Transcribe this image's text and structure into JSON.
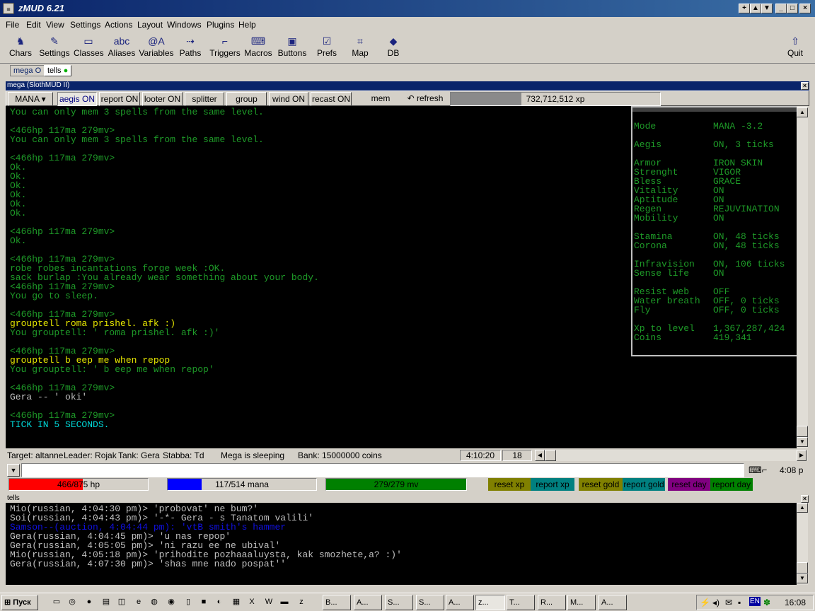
{
  "title": "zMUD 6.21",
  "menu": [
    "File",
    "Edit",
    "View",
    "Settings",
    "Actions",
    "Layout",
    "Windows",
    "Plugins",
    "Help"
  ],
  "toolbar": [
    {
      "label": "Chars",
      "icon": "chars-icon",
      "glyph": "♞"
    },
    {
      "label": "Settings",
      "icon": "settings-icon",
      "glyph": "✎"
    },
    {
      "label": "Classes",
      "icon": "folder-icon",
      "glyph": "▭"
    },
    {
      "label": "Aliases",
      "icon": "aliases-icon",
      "glyph": "abc"
    },
    {
      "label": "Variables",
      "icon": "variables-icon",
      "glyph": "@A"
    },
    {
      "label": "Paths",
      "icon": "paths-icon",
      "glyph": "⇢"
    },
    {
      "label": "Triggers",
      "icon": "triggers-icon",
      "glyph": "⌐"
    },
    {
      "label": "Macros",
      "icon": "macros-icon",
      "glyph": "⌨"
    },
    {
      "label": "Buttons",
      "icon": "buttons-icon",
      "glyph": "▣"
    },
    {
      "label": "Prefs",
      "icon": "prefs-icon",
      "glyph": "☑"
    },
    {
      "label": "Map",
      "icon": "map-icon",
      "glyph": "⌗"
    },
    {
      "label": "DB",
      "icon": "db-icon",
      "glyph": "◆"
    }
  ],
  "quit_label": "Quit",
  "sessions": [
    {
      "label": "mega",
      "status": "O"
    },
    {
      "label": "tells",
      "status": "●"
    }
  ],
  "mega_window_title": "mega (SlothMUD II)",
  "buttons": [
    "MANA",
    "aegis ON",
    "report ON",
    "looter ON",
    "splitter ON",
    "group OFF",
    "wind ON",
    "recast ON",
    "mem",
    "refresh"
  ],
  "xp_display": "732,712,512 xp",
  "colors": {
    "green": "#1e9a28",
    "yellow": "#e6e600",
    "cyan": "#00d7d7",
    "white": "#c0c0c0",
    "blue": "#1010e0"
  },
  "terminal_lines": [
    {
      "t": "You can only mem 3 spells from the same level.",
      "c": "green"
    },
    {
      "t": "",
      "c": "green"
    },
    {
      "t": "<466hp 117ma 279mv>",
      "c": "green"
    },
    {
      "t": "You can only mem 3 spells from the same level.",
      "c": "green"
    },
    {
      "t": "",
      "c": "green"
    },
    {
      "t": "<466hp 117ma 279mv>",
      "c": "green"
    },
    {
      "t": "Ok.",
      "c": "green"
    },
    {
      "t": "Ok.",
      "c": "green"
    },
    {
      "t": "Ok.",
      "c": "green"
    },
    {
      "t": "Ok.",
      "c": "green"
    },
    {
      "t": "Ok.",
      "c": "green"
    },
    {
      "t": "Ok.",
      "c": "green"
    },
    {
      "t": "",
      "c": "green"
    },
    {
      "t": "<466hp 117ma 279mv>",
      "c": "green"
    },
    {
      "t": "Ok.",
      "c": "green"
    },
    {
      "t": "",
      "c": "green"
    },
    {
      "t": "<466hp 117ma 279mv>",
      "c": "green"
    },
    {
      "t": "robe robes incantations forge week :OK.",
      "c": "green"
    },
    {
      "t": "sack burlap :You already wear something about your body.",
      "c": "green"
    },
    {
      "t": "<466hp 117ma 279mv>",
      "c": "green"
    },
    {
      "t": "You go to sleep.",
      "c": "green"
    },
    {
      "t": "",
      "c": "green"
    },
    {
      "t": "<466hp 117ma 279mv>",
      "c": "green"
    },
    {
      "t": "grouptell roma prishel. afk :)",
      "c": "yellow"
    },
    {
      "t": "You grouptell: ' roma prishel. afk :)'",
      "c": "green"
    },
    {
      "t": "",
      "c": "green"
    },
    {
      "t": "<466hp 117ma 279mv>",
      "c": "green"
    },
    {
      "t": "grouptell b eep me when repop",
      "c": "yellow"
    },
    {
      "t": "You grouptell: ' b eep me when repop'",
      "c": "green"
    },
    {
      "t": "",
      "c": "green"
    },
    {
      "t": "<466hp 117ma 279mv>",
      "c": "green"
    },
    {
      "t": "Gera -- ' oki'",
      "c": "white"
    },
    {
      "t": "",
      "c": "green"
    },
    {
      "t": "<466hp 117ma 279mv>",
      "c": "green"
    },
    {
      "t": "TICK IN 5 SECONDS.",
      "c": "cyan"
    }
  ],
  "status_pane": [
    {
      "k": "Mode",
      "v": "MANA -3.2"
    },
    {
      "k": "",
      "v": ""
    },
    {
      "k": "Aegis",
      "v": "ON, 3 ticks"
    },
    {
      "k": "",
      "v": ""
    },
    {
      "k": "Armor",
      "v": "IRON SKIN"
    },
    {
      "k": "Strenght",
      "v": "VIGOR"
    },
    {
      "k": "Bless",
      "v": "GRACE"
    },
    {
      "k": "Vitality",
      "v": "ON"
    },
    {
      "k": "Aptitude",
      "v": "ON"
    },
    {
      "k": "Regen",
      "v": "REJUVINATION"
    },
    {
      "k": "Mobility",
      "v": "ON"
    },
    {
      "k": "",
      "v": ""
    },
    {
      "k": "Stamina",
      "v": "ON, 48 ticks"
    },
    {
      "k": "Corona",
      "v": "ON, 48 ticks"
    },
    {
      "k": "",
      "v": ""
    },
    {
      "k": "Infravision",
      "v": "ON, 106 ticks"
    },
    {
      "k": "Sense life",
      "v": "ON"
    },
    {
      "k": "",
      "v": ""
    },
    {
      "k": "Resist web",
      "v": "OFF"
    },
    {
      "k": "Water breath",
      "v": "OFF, 0 ticks"
    },
    {
      "k": "Fly",
      "v": "OFF, 0 ticks"
    },
    {
      "k": "",
      "v": ""
    },
    {
      "k": "Xp to level",
      "v": "1,367,287,424"
    },
    {
      "k": "Coins",
      "v": "419,341"
    }
  ],
  "info": {
    "target": "Target: altanne",
    "leader": "Leader: Rojak",
    "tank": "Tank: Gera",
    "stabba": "Stabba: Td",
    "state": "Mega is sleeping",
    "bank": "Bank: 15000000 coins",
    "timer": "4:10:20",
    "count": "18"
  },
  "clock": "4:08 p",
  "bars": {
    "hp": "466/875 hp",
    "hp_fraction": 0.53,
    "mana": "117/514 mana",
    "mana_fraction": 0.23,
    "mv": "279/279 mv",
    "mv_fraction": 1.0
  },
  "report_buttons": [
    "reset xp",
    "report xp",
    "reset gold",
    "report gold",
    "reset day",
    "report day"
  ],
  "tells_title": "tells",
  "tells_lines": [
    {
      "t": "Mio(russian, 4:04:30 pm)> 'probovat' ne bum?'",
      "c": "white"
    },
    {
      "t": "Soi(russian, 4:04:43 pm)> '-*- Gera - s Tanatom valili'",
      "c": "white"
    },
    {
      "t": "Samson--(auction, 4:04:44 pm): 'vtB smith's hammer",
      "c": "blue"
    },
    {
      "t": "Gera(russian, 4:04:45 pm)> 'u nas repop'",
      "c": "white"
    },
    {
      "t": "Gera(russian, 4:05:05 pm)> 'ni razu ee ne ubival'",
      "c": "white"
    },
    {
      "t": "Mio(russian, 4:05:18 pm)> 'prihodite pozhaaaluysta, kak smozhete,a? :)'",
      "c": "white"
    },
    {
      "t": "Gera(russian, 4:07:30 pm)> 'shas mne nado pospat''",
      "c": "white"
    }
  ],
  "taskbar": {
    "start": "Пуск",
    "tasks": [
      "B...",
      "A...",
      "S...",
      "S...",
      "A...",
      "z...",
      "T...",
      "R...",
      "M...",
      "A..."
    ],
    "lang": "EN",
    "time": "16:08"
  }
}
